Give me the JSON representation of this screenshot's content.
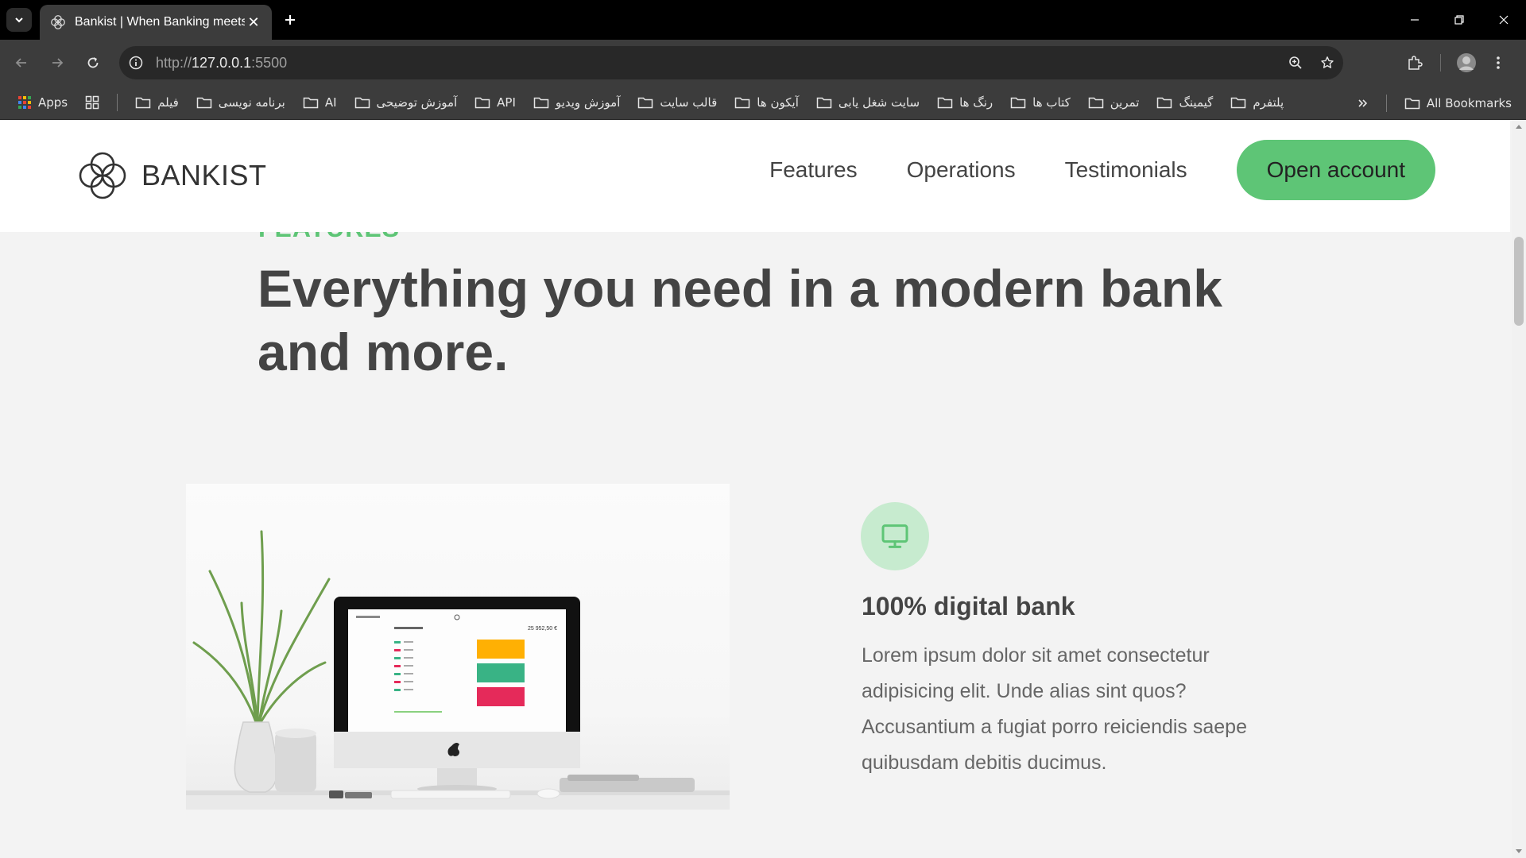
{
  "browser": {
    "tab_title": "Bankist | When Banking meets M",
    "url_scheme": "http://",
    "url_host": "127.0.0.1",
    "url_port": ":5500",
    "bookmarks": [
      {
        "label": "Apps",
        "type": "apps"
      },
      {
        "label": "فیلم",
        "type": "folder"
      },
      {
        "label": "برنامه نویسی",
        "type": "folder"
      },
      {
        "label": "AI",
        "type": "folder"
      },
      {
        "label": "آموزش توضیحی",
        "type": "folder"
      },
      {
        "label": "API",
        "type": "folder"
      },
      {
        "label": "آموزش ویدیو",
        "type": "folder"
      },
      {
        "label": "قالب سایت",
        "type": "folder"
      },
      {
        "label": "آیکون ها",
        "type": "folder"
      },
      {
        "label": "سایت شغل یابی",
        "type": "folder"
      },
      {
        "label": "رنگ ها",
        "type": "folder"
      },
      {
        "label": "کتاب ها",
        "type": "folder"
      },
      {
        "label": "تمرین",
        "type": "folder"
      },
      {
        "label": "گیمینگ",
        "type": "folder"
      },
      {
        "label": "پلتفرم",
        "type": "folder"
      }
    ],
    "all_bookmarks": "All Bookmarks"
  },
  "site": {
    "logo_text": "BANKIST",
    "nav": {
      "features": "Features",
      "operations": "Operations",
      "testimonials": "Testimonials",
      "cta": "Open account"
    },
    "section_kicker": "FEATURES",
    "section_title": "Everything you need in a modern bank and more.",
    "feature": {
      "heading": "100% digital bank",
      "text": "Lorem ipsum dolor sit amet consectetur adipisicing elit. Unde alias sint quos? Accusantium a fugiat porro reiciendis saepe quibusdam debitis ducimus.",
      "icon": "monitor-icon"
    },
    "mockup": {
      "balance": "25 952,50 €"
    }
  },
  "colors": {
    "brand_green": "#5ec576",
    "icon_bg": "#c7ebcf",
    "text_dark": "#444444"
  }
}
